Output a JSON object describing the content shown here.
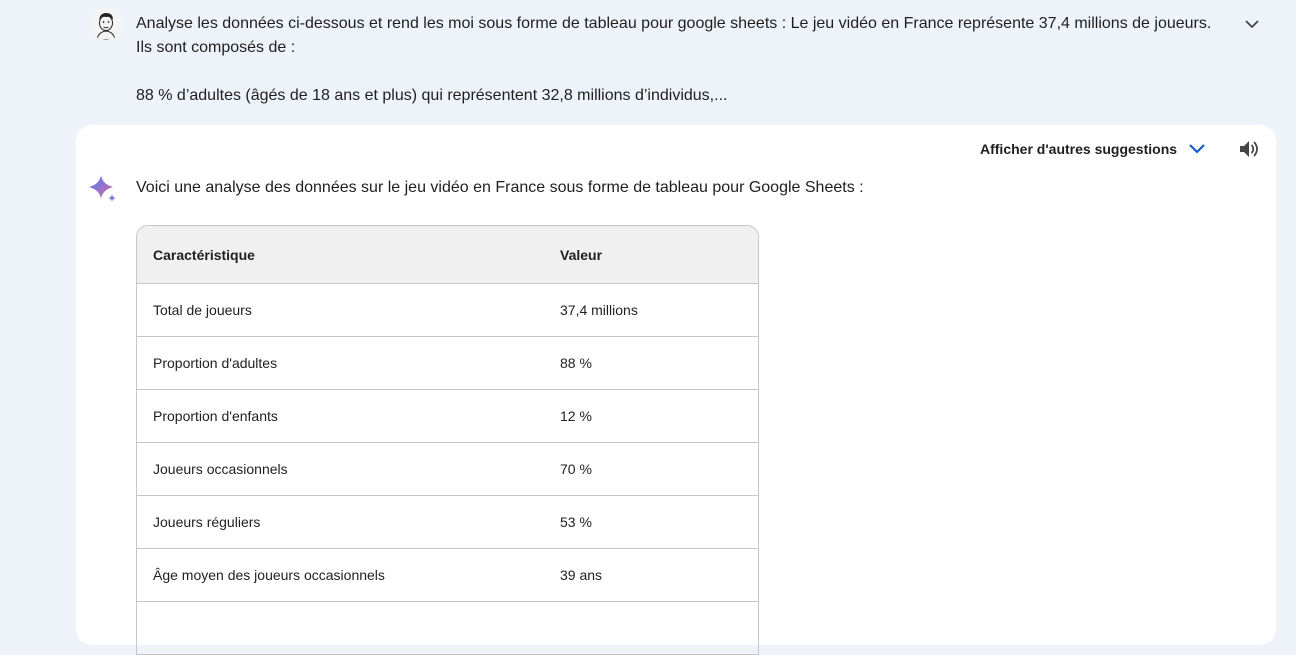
{
  "user_prompt": {
    "line1": "Analyse les données ci-dessous et rend les moi sous forme de tableau pour google sheets : Le jeu vidéo en France représente 37,4 millions de joueurs.",
    "line2": "Ils sont composés de :",
    "line3": "88 % d’adultes (âgés de 18 ans et plus) qui représentent 32,8 millions d’individus,..."
  },
  "response": {
    "drafts_label": "Afficher d'autres suggestions",
    "intro": "Voici une analyse des données sur le jeu vidéo en France sous forme de tableau pour Google Sheets :"
  },
  "table": {
    "headers": [
      "Caractéristique",
      "Valeur"
    ],
    "rows": [
      [
        "Total de joueurs",
        "37,4 millions"
      ],
      [
        "Proportion d'adultes",
        "88 %"
      ],
      [
        "Proportion d'enfants",
        "12 %"
      ],
      [
        "Joueurs occasionnels",
        "70 %"
      ],
      [
        "Joueurs réguliers",
        "53 %"
      ],
      [
        "Âge moyen des joueurs occasionnels",
        "39 ans"
      ],
      [
        "",
        ""
      ]
    ]
  },
  "icons": {
    "avatar": "user-avatar",
    "expand": "chevron-down-icon",
    "drafts": "chevron-down-icon",
    "speaker": "speaker-icon",
    "gemini": "gemini-sparkle-icon"
  },
  "colors": {
    "page_bg": "#eef2f9",
    "card_bg": "#ffffff",
    "accent_blue": "#0b57d0",
    "header_bg": "#f0f0f0"
  }
}
